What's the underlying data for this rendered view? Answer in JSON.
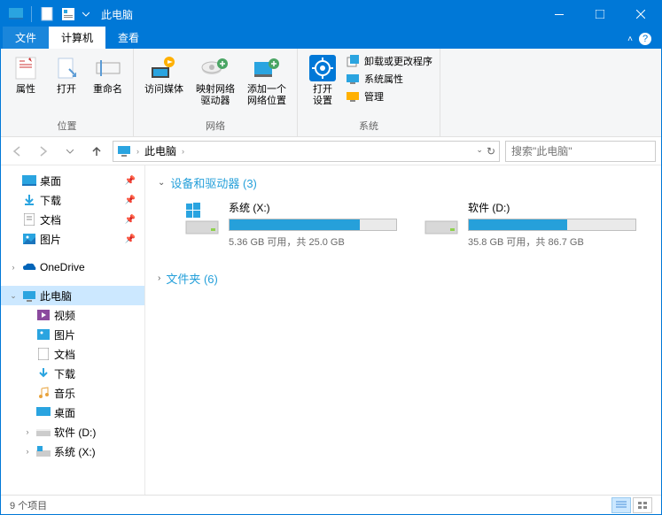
{
  "window": {
    "title": "此电脑"
  },
  "tabs": {
    "file": "文件",
    "computer": "计算机",
    "view": "查看"
  },
  "ribbon": {
    "group_location": "位置",
    "group_network": "网络",
    "group_system": "系统",
    "properties": "属性",
    "open": "打开",
    "rename": "重命名",
    "access_media": "访问媒体",
    "map_drive": "映射网络\n驱动器",
    "add_loc": "添加一个\n网络位置",
    "open_settings": "打开\n设置",
    "uninstall": "卸载或更改程序",
    "sysprops": "系统属性",
    "manage": "管理"
  },
  "address": {
    "root": "此电脑",
    "search_placeholder": "搜索\"此电脑\""
  },
  "nav": {
    "desktop": "桌面",
    "downloads": "下载",
    "documents": "文档",
    "pictures": "图片",
    "onedrive": "OneDrive",
    "thispc": "此电脑",
    "videos": "视频",
    "pictures2": "图片",
    "documents2": "文档",
    "downloads2": "下载",
    "music": "音乐",
    "desktop2": "桌面",
    "drive_d": "软件 (D:)",
    "drive_x": "系统 (X:)"
  },
  "sections": {
    "devices": "设备和驱动器 (3)",
    "folders": "文件夹 (6)"
  },
  "drives": [
    {
      "name": "系统 (X:)",
      "text": "5.36 GB 可用，共 25.0 GB",
      "fill": 78
    },
    {
      "name": "软件 (D:)",
      "text": "35.8 GB 可用，共 86.7 GB",
      "fill": 59
    }
  ],
  "status": {
    "items": "9 个项目"
  }
}
